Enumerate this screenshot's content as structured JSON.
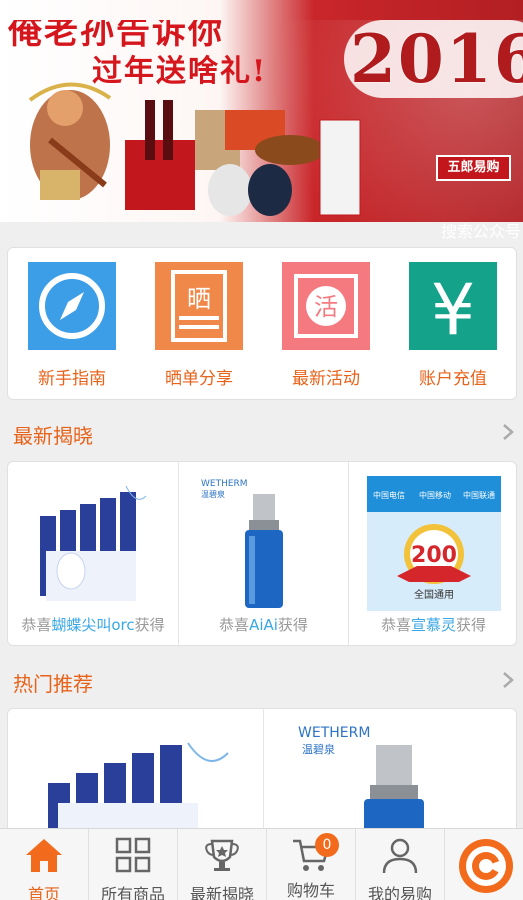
{
  "banner": {
    "slogan_line1": "俺老孙告诉你",
    "slogan_line2": "过年送啥礼!",
    "year": "2016",
    "brand": "五郎易购",
    "strip_label": "搜索公众号"
  },
  "quick_menu": [
    {
      "label": "新手指南",
      "icon": "compass-icon",
      "color": "#3d9ee8"
    },
    {
      "label": "晒单分享",
      "icon": "share-note-icon",
      "glyph": "晒",
      "color": "#f0884a"
    },
    {
      "label": "最新活动",
      "icon": "activity-icon",
      "glyph": "活",
      "color": "#f47a80"
    },
    {
      "label": "账户充值",
      "icon": "yen-icon",
      "glyph": "¥",
      "color": "#14a38a"
    }
  ],
  "latest": {
    "title": "最新揭晓",
    "items": [
      {
        "prefix": "恭喜",
        "user": "蝴蝶尖叫orc",
        "suffix": "获得",
        "product": "facial-mask-box"
      },
      {
        "prefix": "恭喜",
        "user": "AiAi",
        "suffix": "获得",
        "product": "wetherm-serum",
        "brand": "WETHERM",
        "brand_cn": "温碧泉"
      },
      {
        "prefix": "恭喜",
        "user": "宣慕灵",
        "suffix": "获得",
        "product": "phone-card-200",
        "amount": "200",
        "card_text": "全国通用",
        "carrier_labels": [
          "中国电信",
          "中国移动",
          "中国联通"
        ]
      }
    ]
  },
  "hot": {
    "title": "热门推荐",
    "items": [
      {
        "product": "facial-mask-box"
      },
      {
        "product": "wetherm-serum",
        "brand": "WETHERM",
        "brand_cn": "温碧泉"
      }
    ]
  },
  "tabbar": {
    "items": [
      {
        "label": "首页",
        "icon": "home-icon",
        "active": true
      },
      {
        "label": "所有商品",
        "icon": "grid-icon",
        "active": false
      },
      {
        "label": "最新揭晓",
        "icon": "trophy-icon",
        "active": false
      },
      {
        "label": "购物车",
        "icon": "cart-icon",
        "active": false,
        "badge": "0"
      },
      {
        "label": "我的易购",
        "icon": "user-icon",
        "active": false
      }
    ],
    "refresh_icon": "refresh-icon"
  },
  "colors": {
    "accent": "#e8631a",
    "strip": "#f26b1d",
    "link_user": "#39a7e5",
    "banner_red": "#c3161c"
  }
}
